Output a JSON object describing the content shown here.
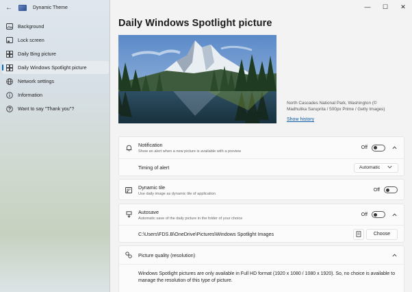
{
  "window": {
    "app_title": "Dynamic Theme",
    "back_glyph": "←",
    "minimize_glyph": "—",
    "maximize_glyph": "☐",
    "close_glyph": "✕"
  },
  "sidebar": {
    "items": [
      {
        "label": "Background",
        "icon": "image-icon"
      },
      {
        "label": "Lock screen",
        "icon": "lock-screen-icon"
      },
      {
        "label": "Daily Bing picture",
        "icon": "tiles-icon"
      },
      {
        "label": "Daily Windows Spotlight picture",
        "icon": "tiles-icon",
        "active": true
      },
      {
        "label": "Network settings",
        "icon": "globe-icon"
      },
      {
        "label": "Information",
        "icon": "info-icon"
      },
      {
        "label": "Want to say \"Thank you\"?",
        "icon": "question-icon"
      }
    ],
    "accent": "#0067c0"
  },
  "main": {
    "title": "Daily Windows Spotlight picture",
    "caption": "North Cascades National Park, Washington (© Madhulika Saruprita / 500px Prime / Getty Images)",
    "show_history": "Show history",
    "notification": {
      "title": "Notification",
      "subtitle": "Show an alert when a new picture is available with a preview",
      "state": "Off",
      "timing_label": "Timing of alert",
      "timing_value": "Automatic"
    },
    "dynamic_tile": {
      "title": "Dynamic tile",
      "subtitle": "Use daily image as dynamic tile of application",
      "state": "Off"
    },
    "autosave": {
      "title": "Autosave",
      "subtitle": "Automatic save of the daily picture in the folder of your choice",
      "state": "Off",
      "path": "C:\\Users\\FDS.B\\OneDrive\\Pictures\\Windows Spotlight Images",
      "choose_label": "Choose"
    },
    "picture_quality": {
      "title": "Picture quality (resolution)",
      "note": "Windows Spotlight pictures are only available in Full HD format (1920 x 1080 / 1080 x 1920). So, no choice is available to manage the resolution of this type of picture."
    },
    "link_color": "#0a5aa6"
  }
}
